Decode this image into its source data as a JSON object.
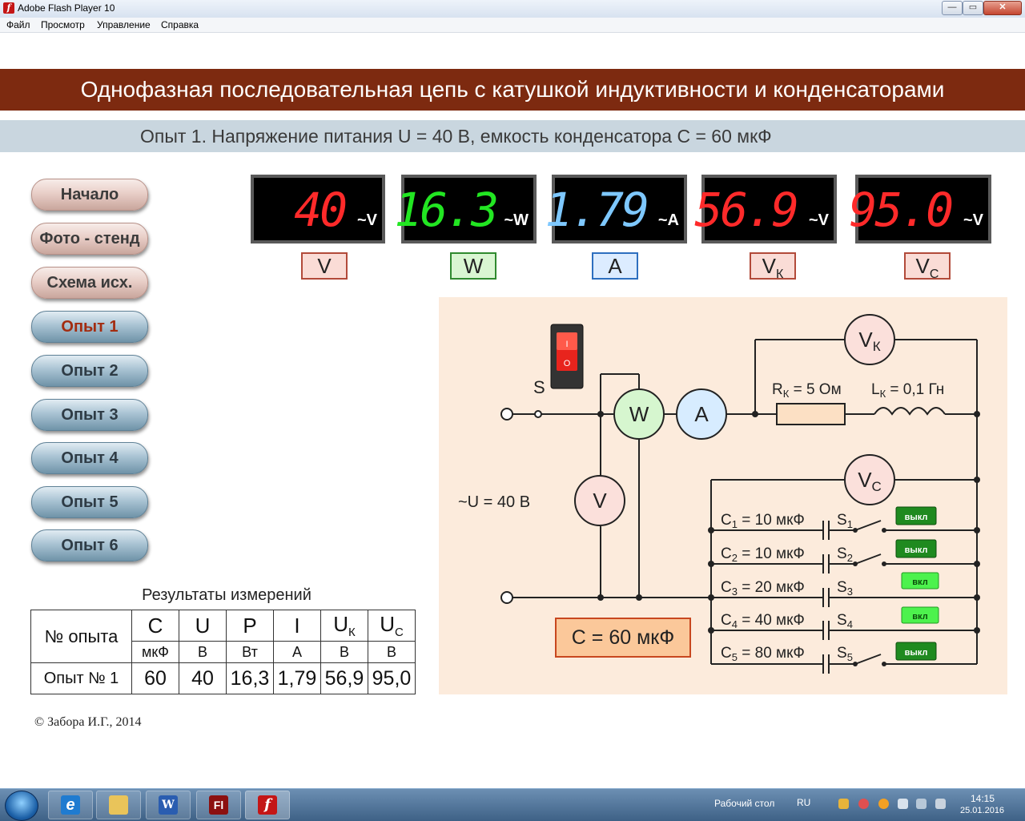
{
  "window": {
    "title": "Adobe Flash Player 10",
    "btn_min": "—",
    "btn_max": "▭",
    "btn_close": "✕",
    "app_icon": "f"
  },
  "menu": [
    "Файл",
    "Просмотр",
    "Управление",
    "Справка"
  ],
  "header": {
    "title": "Однофазная последовательная цепь с катушкой индуктивности и конденсаторами",
    "subtitle": "Опыт 1. Напряжение питания U = 40 В, емкость конденсатора С = 60 мкФ"
  },
  "nav": [
    "Начало",
    "Фото - стенд",
    "Схема исх.",
    "Опыт 1",
    "Опыт 2",
    "Опыт 3",
    "Опыт 4",
    "Опыт 5",
    "Опыт 6"
  ],
  "nav_active": "Опыт 1",
  "meters": [
    {
      "value": "40",
      "unit": "~V",
      "label": "V",
      "sub": "",
      "color": "#ff2a2a"
    },
    {
      "value": "16.3",
      "unit": "~W",
      "label": "W",
      "sub": "",
      "color": "#22e622"
    },
    {
      "value": "1.79",
      "unit": "~A",
      "label": "A",
      "sub": "",
      "color": "#7ec8ff"
    },
    {
      "value": "56.9",
      "unit": "~V",
      "label": "V",
      "sub": "К",
      "color": "#ff2a2a"
    },
    {
      "value": "95.0",
      "unit": "~V",
      "label": "V",
      "sub": "C",
      "color": "#ff2a2a"
    }
  ],
  "circuit": {
    "switch_label": "S",
    "supply_label": "~U = 40 В",
    "meter_V": "V",
    "meter_W": "W",
    "meter_A": "A",
    "meter_Vk": "V",
    "meter_Vk_sub": "К",
    "meter_Vc": "V",
    "meter_Vc_sub": "C",
    "rk_label": "R",
    "rk_sub": "К",
    "rk_val": " = 5 Ом",
    "lk_label": "L",
    "lk_sub": "К",
    "lk_val": " = 0,1 Гн",
    "total_c": "С = 60  мкФ",
    "caps": [
      {
        "name": "C",
        "sub": "1",
        "val": " = 10 мкФ",
        "sw": "S",
        "sw_sub": "1",
        "state": "выкл"
      },
      {
        "name": "C",
        "sub": "2",
        "val": " = 10 мкФ",
        "sw": "S",
        "sw_sub": "2",
        "state": "выкл"
      },
      {
        "name": "C",
        "sub": "3",
        "val": " = 20 мкФ",
        "sw": "S",
        "sw_sub": "3",
        "state": "вкл"
      },
      {
        "name": "C",
        "sub": "4",
        "val": " = 40 мкФ",
        "sw": "S",
        "sw_sub": "4",
        "state": "вкл"
      },
      {
        "name": "C",
        "sub": "5",
        "val": " = 80 мкФ",
        "sw": "S",
        "sw_sub": "5",
        "state": "выкл"
      }
    ]
  },
  "results": {
    "title": "Результаты измерений",
    "headers": [
      "№ опыта",
      "C",
      "U",
      "P",
      "I",
      "U",
      "U"
    ],
    "header_subs": [
      "",
      "",
      "",
      "",
      "",
      "К",
      "С"
    ],
    "units": [
      "",
      "мкФ",
      "В",
      "Вт",
      "А",
      "В",
      "В"
    ],
    "rows": [
      [
        "Опыт № 1",
        "60",
        "40",
        "16,3",
        "1,79",
        "56,9",
        "95,0"
      ]
    ]
  },
  "copyright": "© Забора И.Г., 2014",
  "taskbar": {
    "desktop_label": "Рабочий стол",
    "lang": "RU",
    "time": "14:15",
    "date": "25.01.2016",
    "apps": [
      "ie-icon",
      "explorer-icon",
      "word-icon",
      "flash-pro-icon",
      "flash-player-icon"
    ],
    "app_glyphs": [
      "e",
      "",
      "W",
      "Fl",
      "f"
    ]
  }
}
